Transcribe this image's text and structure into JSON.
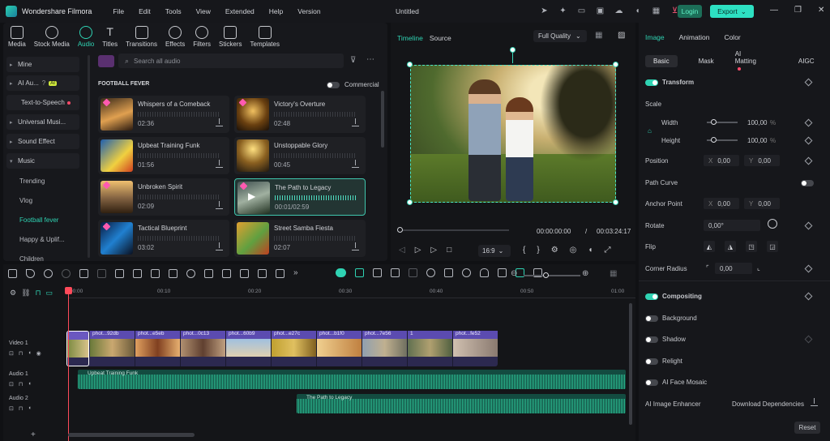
{
  "titlebar": {
    "app_name": "Wondershare Filmora",
    "menus": [
      "File",
      "Edit",
      "Tools",
      "View",
      "Extended",
      "Help",
      "Version"
    ],
    "document_title": "Untitled",
    "login_label": "Login",
    "export_label": "Export"
  },
  "library": {
    "tabs": [
      {
        "label": "Media",
        "icon": "media-icon"
      },
      {
        "label": "Stock Media",
        "icon": "stock-media-icon"
      },
      {
        "label": "Audio",
        "icon": "audio-icon",
        "active": true
      },
      {
        "label": "Titles",
        "icon": "titles-icon"
      },
      {
        "label": "Transitions",
        "icon": "transitions-icon"
      },
      {
        "label": "Effects",
        "icon": "effects-icon"
      },
      {
        "label": "Filters",
        "icon": "filters-icon"
      },
      {
        "label": "Stickers",
        "icon": "stickers-icon"
      },
      {
        "label": "Templates",
        "icon": "templates-icon"
      }
    ],
    "sidebar": {
      "items": [
        "Mine",
        "AI Au...",
        "Text-to-Speech",
        "Universal Musi...",
        "Sound Effect",
        "Music"
      ],
      "ai_badge": "AI",
      "music_subitems": [
        "Trending",
        "Vlog",
        "Football fever",
        "Happy & Uplif...",
        "Children"
      ]
    },
    "search_placeholder": "Search all audio",
    "section_title": "FOOTBALL FEVER",
    "commercial_label": "Commercial",
    "tracks": [
      {
        "title": "Whispers of a Comeback",
        "duration": "02:36"
      },
      {
        "title": "Victory's Overture",
        "duration": "02:48"
      },
      {
        "title": "Upbeat Training Funk",
        "duration": "01:56"
      },
      {
        "title": "Unstoppable Glory",
        "duration": "00:45"
      },
      {
        "title": "Unbroken Spirit",
        "duration": "02:09"
      },
      {
        "title": "The Path to Legacy",
        "duration": "00:01/02:59"
      },
      {
        "title": "Tactical Blueprint",
        "duration": "03:02"
      },
      {
        "title": "Street Samba Fiesta",
        "duration": "02:07"
      }
    ]
  },
  "preview": {
    "tab_timeline": "Timeline",
    "tab_source": "Source",
    "quality": "Full Quality",
    "current_time": "00:00:00:00",
    "separator": "/",
    "total_time": "00:03:24:17",
    "aspect": "16:9"
  },
  "properties": {
    "tabs": [
      "Image",
      "Animation",
      "Color"
    ],
    "subtabs": [
      "Basic",
      "Mask",
      "AI Matting",
      "AIGC"
    ],
    "transform_label": "Transform",
    "scale_label": "Scale",
    "width_label": "Width",
    "width_value": "100,00",
    "height_label": "Height",
    "height_value": "100,00",
    "percent": "%",
    "position_label": "Position",
    "position_x": "0,00",
    "position_y": "0,00",
    "x_label": "X",
    "y_label": "Y",
    "path_curve_label": "Path Curve",
    "anchor_label": "Anchor Point",
    "anchor_x": "0,00",
    "anchor_y": "0,00",
    "rotate_label": "Rotate",
    "rotate_value": "0,00°",
    "flip_label": "Flip",
    "corner_label": "Corner Radius",
    "corner_value": "0,00",
    "compositing_label": "Compositing",
    "background_label": "Background",
    "shadow_label": "Shadow",
    "relight_label": "Relight",
    "face_mosaic_label": "AI Face Mosaic",
    "enhancer_label": "AI Image Enhancer",
    "download_label": "Download Dependencies",
    "reset_label": "Reset"
  },
  "timeline": {
    "ruler": [
      "00:00",
      "00:10",
      "00:20",
      "00:30",
      "00:40",
      "00:50",
      "01:00"
    ],
    "tracks": {
      "video1": "Video 1",
      "audio1": "Audio 1",
      "audio2": "Audio 2"
    },
    "clips": [
      "phot...92db",
      "phot...e5eb",
      "phot...0c13",
      "phot...60b9",
      "phot...e27c",
      "phot...b1f0",
      "phot...7e56",
      "1",
      "phot...fe52"
    ],
    "audio1_clip": "Upbeat Training Funk",
    "audio2_clip": "The Path to Legacy",
    "colors": {
      "accent": "#2fd3b3",
      "video_clip": "#5b4bb0",
      "audio_clip": "#2fcf9f",
      "playhead": "#ff4a5a"
    }
  }
}
